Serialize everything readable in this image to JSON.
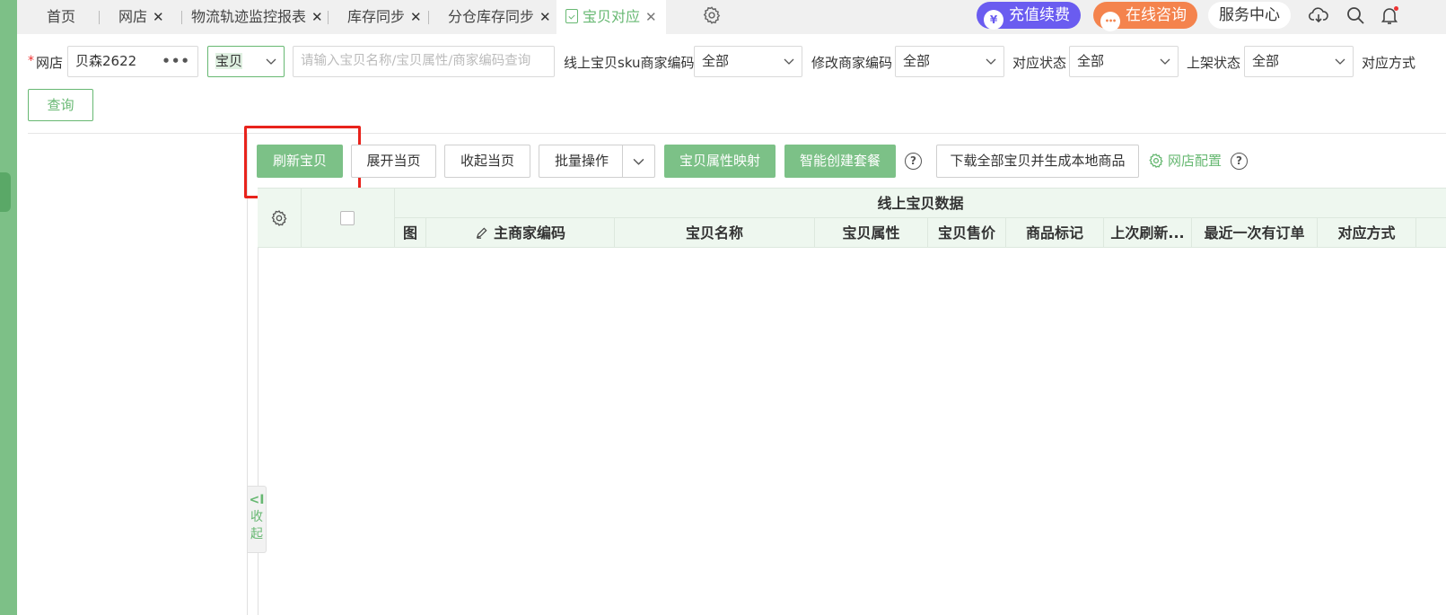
{
  "tabs": {
    "home": "首页",
    "shop": "网店",
    "logistics": "物流轨迹监控报表",
    "stock_sync": "库存同步",
    "warehouse_sync": "分仓库存同步",
    "item_match": "宝贝对应",
    "close_glyph": "✕"
  },
  "header": {
    "recharge": "充值续费",
    "consult": "在线咨询",
    "service": "服务中心",
    "recharge_icon_glyph": "¥",
    "consult_icon_glyph": "•••"
  },
  "filters": {
    "required_mark": "*",
    "shop_label": "网店",
    "shop_value": "贝森2622",
    "shop_picker_glyph": "•••",
    "type_value": "宝贝",
    "search_placeholder": "请输入宝贝名称/宝贝属性/商家编码查询",
    "sku_code_label": "线上宝贝sku商家编码",
    "sku_code_value": "全部",
    "modify_code_label": "修改商家编码",
    "modify_code_value": "全部",
    "match_status_label": "对应状态",
    "match_status_value": "全部",
    "listing_status_label": "上架状态",
    "listing_status_value": "全部",
    "match_method_label": "对应方式",
    "query_button": "查询"
  },
  "toolbar": {
    "refresh": "刷新宝贝",
    "expand": "展开当页",
    "collapse": "收起当页",
    "batch": "批量操作",
    "attr_mapping": "宝贝属性映射",
    "smart_bundle": "智能创建套餐",
    "download_all": "下载全部宝贝并生成本地商品",
    "shop_config": "网店配置",
    "help_glyph": "?"
  },
  "table": {
    "group_header": "线上宝贝数据",
    "columns": {
      "image": "图",
      "main_code": "主商家编码",
      "name": "宝贝名称",
      "attrs": "宝贝属性",
      "price": "宝贝售价",
      "mark": "商品标记",
      "last_refresh": "上次刷新...",
      "recent_order": "最近一次有订单",
      "match_method": "对应方式"
    },
    "rows": []
  },
  "side": {
    "collapse_icon": "<I",
    "collapse_1": "收",
    "collapse_2": "起"
  },
  "colors": {
    "accent": "#67b872",
    "button_green": "#7cc187",
    "highlight_red": "#e8231c",
    "recharge_pill": "#6a5cf0",
    "consult_pill": "#f4834d"
  }
}
